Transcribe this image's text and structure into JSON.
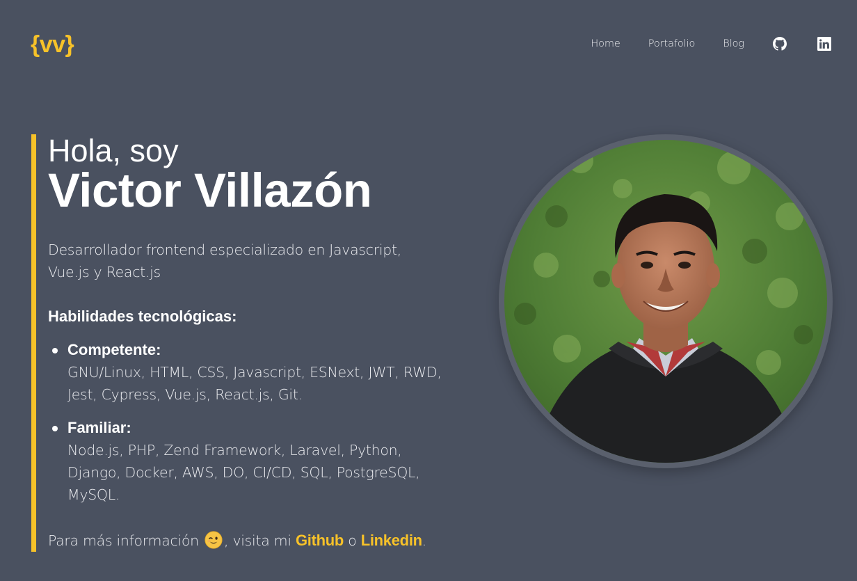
{
  "header": {
    "logo": "{vv}",
    "nav": {
      "home": "Home",
      "portfolio": "Portafolio",
      "blog": "Blog"
    },
    "social_icons": [
      "github-icon",
      "linkedin-icon"
    ]
  },
  "intro": {
    "greeting": "Hola, soy",
    "name": "Victor Villazón",
    "tagline": "Desarrollador frontend especializado en Javascript, Vue.js y React.js",
    "skills_title": "Habilidades tecnológicas:",
    "skills": [
      {
        "label": "Competente:",
        "items": "GNU/Linux, HTML, CSS, Javascript, ESNext, JWT, RWD, Jest, Cypress, Vue.js, React.js, Git."
      },
      {
        "label": "Familiar:",
        "items": "Node.js, PHP, Zend Framework, Laravel, Python, Django, Docker, AWS, DO, CI/CD, SQL, PostgreSQL, MySQL."
      }
    ],
    "more_info": {
      "prefix": "Para más información",
      "emoji": "winking-face-icon",
      "middle": ", visita mi",
      "github_link": "Github",
      "connector": "o",
      "linkedin_link": "Linkedin",
      "suffix": "."
    }
  },
  "colors": {
    "background": "#4a5160",
    "accent": "#f7c229",
    "text": "#ffffff"
  }
}
